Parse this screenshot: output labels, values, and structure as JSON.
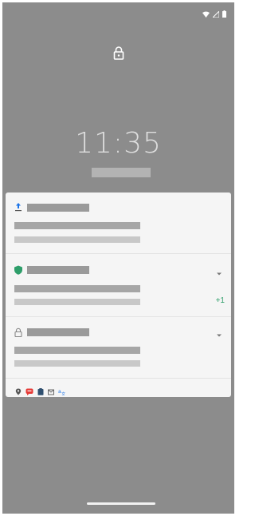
{
  "status_bar": {
    "icons": [
      "wifi-icon",
      "signal-icon",
      "battery-icon"
    ]
  },
  "lockscreen": {
    "lock_icon": "padlock-icon",
    "time": "11:35"
  },
  "notifications": [
    {
      "app_icon": "upload-icon",
      "expandable": false,
      "extra_count": ""
    },
    {
      "app_icon": "shield-icon",
      "expandable": true,
      "extra_count": "+1"
    },
    {
      "app_icon": "padlock-icon",
      "expandable": true,
      "extra_count": ""
    }
  ],
  "overflow_icons": [
    "location-icon",
    "chat-icon",
    "clipboard-icon",
    "mail-icon",
    "translate-icon"
  ],
  "colors": {
    "background": "#8c8c8c",
    "card": "#f5f5f5",
    "accent_green": "#2e9e6a",
    "accent_red": "#e53935",
    "accent_blue": "#1a73e8"
  }
}
